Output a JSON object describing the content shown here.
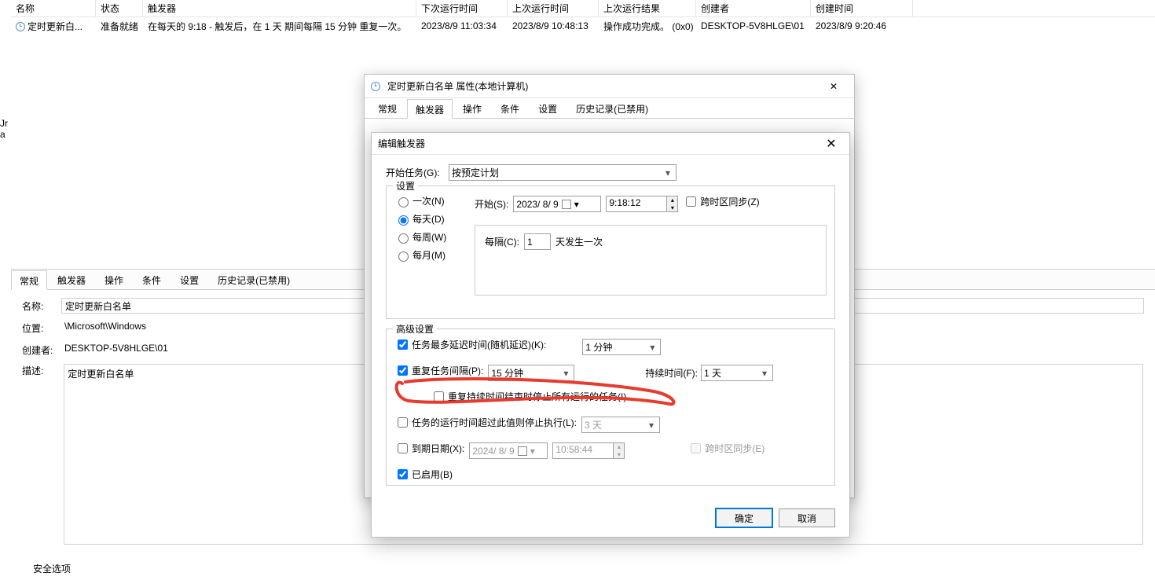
{
  "taskTable": {
    "headers": [
      "名称",
      "状态",
      "触发器",
      "下次运行时间",
      "上次运行时间",
      "上次运行结果",
      "创建者",
      "创建时间"
    ],
    "row": {
      "name": "定时更新白...",
      "state": "准备就绪",
      "trigger": "在每天的 9:18 - 触发后，在 1 天 期间每隔 15 分钟 重复一次。",
      "next": "2023/8/9 11:03:34",
      "last": "2023/8/9 10:48:13",
      "result": "操作成功完成。 (0x0)",
      "creator": "DESKTOP-5V8HLGE\\01",
      "ctime": "2023/8/9 9:20:46"
    }
  },
  "sideTxt": {
    "l0": "Jr",
    "l1": "a"
  },
  "details": {
    "tabs": [
      "常规",
      "触发器",
      "操作",
      "条件",
      "设置",
      "历史记录(已禁用)"
    ],
    "nameLbl": "名称:",
    "name": "定时更新白名单",
    "locLbl": "位置:",
    "loc": "\\Microsoft\\Windows",
    "creatorLbl": "创建者:",
    "creator": "DESKTOP-5V8HLGE\\01",
    "descLbl": "描述:",
    "desc": "定时更新白名单",
    "sec": "安全选项"
  },
  "propWin": {
    "title": "定时更新白名单 属性(本地计算机)",
    "tabs": [
      "常规",
      "触发器",
      "操作",
      "条件",
      "设置",
      "历史记录(已禁用)"
    ]
  },
  "dlg": {
    "title": "编辑触发器",
    "beginLbl": "开始任务(G):",
    "beginVal": "按预定计划",
    "settingsLbl": "设置",
    "radios": {
      "once": "一次(N)",
      "daily": "每天(D)",
      "weekly": "每周(W)",
      "monthly": "每月(M)"
    },
    "startLbl": "开始(S):",
    "startDate": "2023/ 8/ 9",
    "startTime": "9:18:12",
    "tzSync": "跨时区同步(Z)",
    "everyLbl": "每隔(C):",
    "everyVal": "1",
    "everySuffix": "天发生一次",
    "advLbl": "高级设置",
    "delayChk": "任务最多延迟时间(随机延迟)(K):",
    "delayVal": "1 分钟",
    "repeatChk": "重复任务间隔(P):",
    "repeatVal": "15 分钟",
    "durLbl": "持续时间(F):",
    "durVal": "1 天",
    "stopAllChk": "重复持续时间结束时停止所有运行的任务(I)",
    "maxRunChk": "任务的运行时间超过此值则停止执行(L):",
    "maxRunVal": "3 天",
    "expireChk": "到期日期(X):",
    "expireDate": "2024/ 8/ 9",
    "expireTime": "10:58:44",
    "tzSync2": "跨时区同步(E)",
    "enabledChk": "已启用(B)",
    "ok": "确定",
    "cancel": "取消"
  }
}
